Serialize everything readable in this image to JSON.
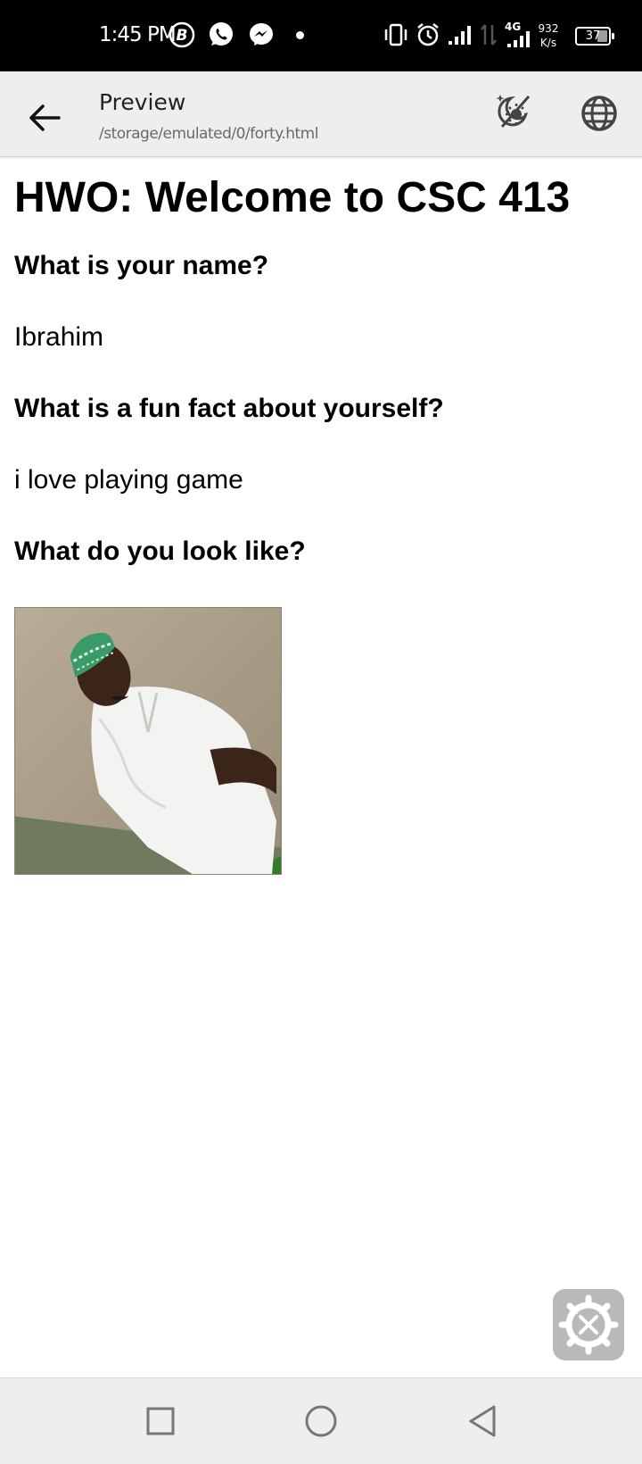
{
  "status_bar": {
    "time": "1:45 PM",
    "network_type": "4G",
    "speed_value": "932",
    "speed_unit": "K/s",
    "battery": "37",
    "icons": [
      "b-app-icon",
      "whatsapp-icon",
      "messenger-icon",
      "vibrate-icon",
      "alarm-icon",
      "signal-icon",
      "data-arrows-icon",
      "signal-4g-icon",
      "battery-icon"
    ]
  },
  "app_bar": {
    "title": "Preview",
    "subtitle": "/storage/emulated/0/forty.html",
    "icons": [
      "back-arrow-icon",
      "theme-toggle-icon",
      "globe-icon"
    ]
  },
  "page": {
    "heading": "HWO: Welcome to CSC 413",
    "q1": "What is your name?",
    "a1": "Ibrahim",
    "q2": "What is a fun fact about yourself?",
    "a2": "i love playing game",
    "q3": "What do you look like?"
  },
  "fab": {
    "icon": "settings-tools-icon"
  },
  "nav_bar": {
    "icons": [
      "recents-square-icon",
      "home-circle-icon",
      "back-triangle-icon"
    ]
  },
  "colors": {
    "status_bar_bg": "#000000",
    "app_bar_bg": "#eeeeee",
    "nav_bar_bg": "#eeeeee",
    "fab_bg": "#b9b9b9",
    "text": "#000000"
  }
}
